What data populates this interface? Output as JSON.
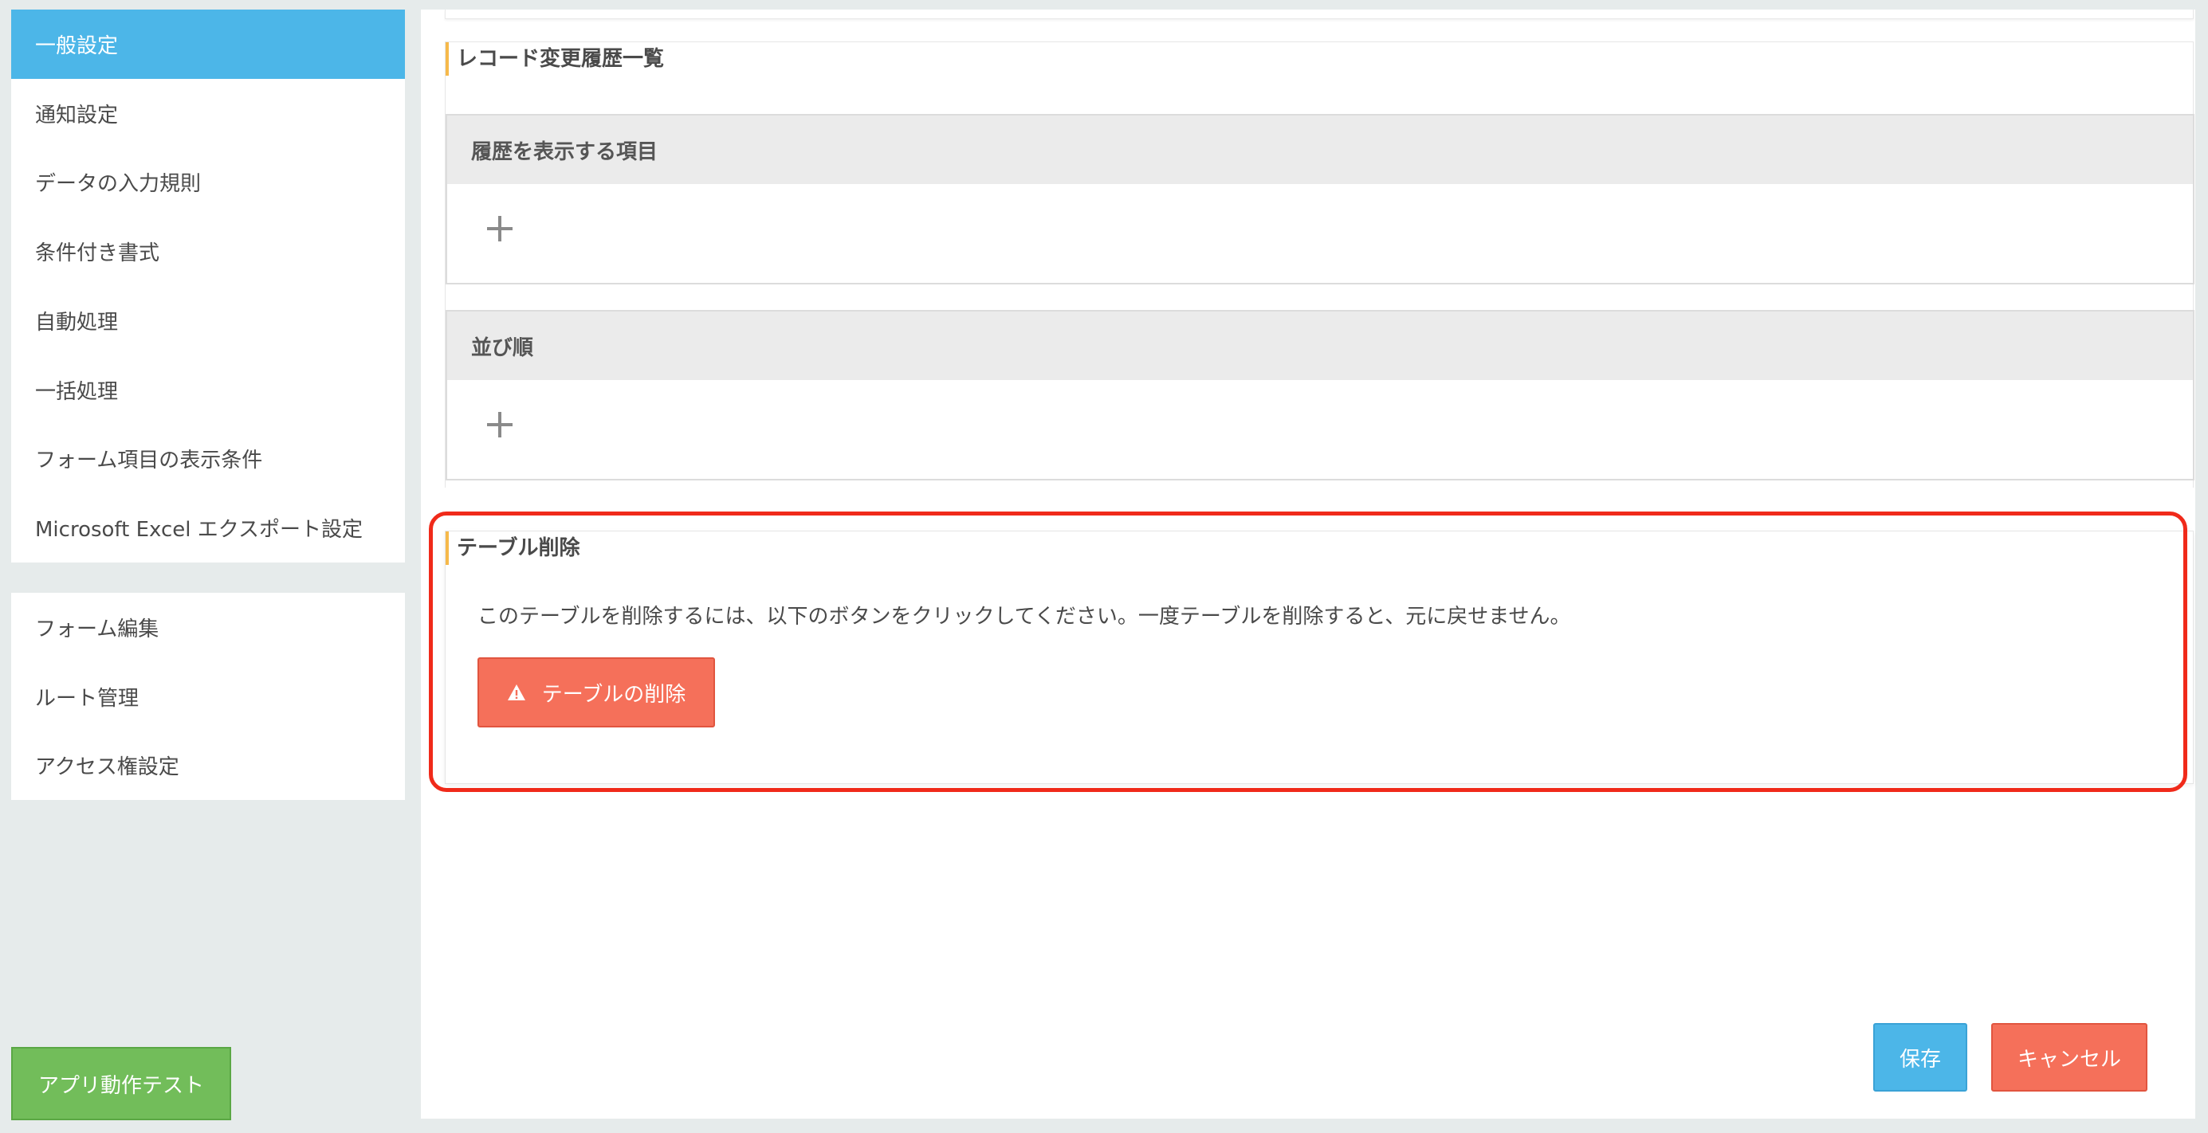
{
  "sidebar": {
    "settings_menu": [
      {
        "label": "一般設定",
        "active": true
      },
      {
        "label": "通知設定"
      },
      {
        "label": "データの入力規則"
      },
      {
        "label": "条件付き書式"
      },
      {
        "label": "自動処理"
      },
      {
        "label": "一括処理"
      },
      {
        "label": "フォーム項目の表示条件"
      },
      {
        "label": "Microsoft Excel エクスポート設定"
      }
    ],
    "manage_menu": [
      {
        "label": "フォーム編集"
      },
      {
        "label": "ルート管理"
      },
      {
        "label": "アクセス権設定"
      }
    ],
    "test_button_label": "アプリ動作テスト"
  },
  "main": {
    "history_section": {
      "title": "レコード変更履歴一覧",
      "fields_header": "履歴を表示する項目",
      "sort_header": "並び順"
    },
    "delete_section": {
      "title": "テーブル削除",
      "description": "このテーブルを削除するには、以下のボタンをクリックしてください。一度テーブルを削除すると、元に戻せません。",
      "button_label": "テーブルの削除"
    },
    "footer": {
      "save_label": "保存",
      "cancel_label": "キャンセル"
    }
  },
  "colors": {
    "active_menu": "#4cb6e8",
    "danger": "#f5705a",
    "success": "#72bd5a",
    "accent_bar": "#f6b94a",
    "highlight": "#f02a1a"
  },
  "icons": {
    "plus": "plus-icon",
    "warning": "warning-icon"
  }
}
